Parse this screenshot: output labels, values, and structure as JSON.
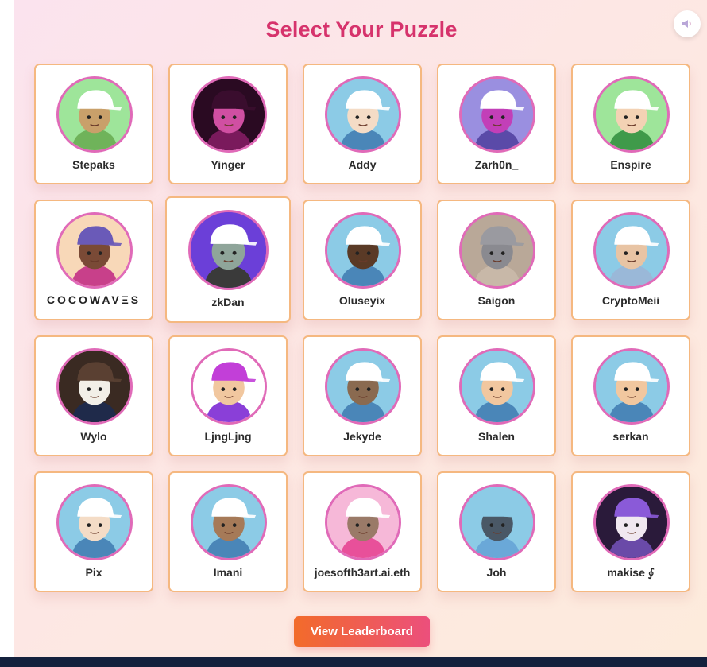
{
  "header": {
    "title": "Select Your Puzzle"
  },
  "sound_button": {
    "icon": "speaker-icon"
  },
  "accent_colors": {
    "title": "#d6336c",
    "card_border": "#f5b880",
    "avatar_ring": "#e06ab8",
    "button_start": "#f26b2a",
    "button_end": "#ec4f7c"
  },
  "puzzles": [
    {
      "name": "Stepaks",
      "bg": "#9ee59a",
      "skin": "#c9a06a",
      "cap": "#ffffff",
      "shirt": "#6fb35a"
    },
    {
      "name": "Yinger",
      "bg": "#2a0a22",
      "skin": "#d04fa2",
      "cap": "#3a0d2e",
      "shirt": "#7a1a5c"
    },
    {
      "name": "Addy",
      "bg": "#8ccbe6",
      "skin": "#f4dcc6",
      "cap": "#ffffff",
      "shirt": "#4a86b8"
    },
    {
      "name": "Zarh0n_",
      "bg": "#9a8fe0",
      "skin": "#c23fb8",
      "cap": "#ffffff",
      "shirt": "#5a4aa8"
    },
    {
      "name": "Enspire",
      "bg": "#9ee59a",
      "skin": "#f3d2b4",
      "cap": "#ffffff",
      "shirt": "#3f9a4a"
    },
    {
      "name": "COCOWAVΞS",
      "bg": "#f8d8b8",
      "skin": "#7a4a36",
      "cap": "#6a5ab8",
      "shirt": "#c8408a"
    },
    {
      "name": "zkDan",
      "bg": "#6b3fd8",
      "skin": "#8fa59a",
      "cap": "#ffffff",
      "shirt": "#3a3a3a"
    },
    {
      "name": "Oluseyix",
      "bg": "#8ccbe6",
      "skin": "#5a3a26",
      "cap": "#ffffff",
      "shirt": "#4a86b8"
    },
    {
      "name": "Saigon",
      "bg": "#b9a898",
      "skin": "#8a8a90",
      "cap": "#9a9aa0",
      "shirt": "#c8b8a8"
    },
    {
      "name": "CryptoMeii",
      "bg": "#8ccbe6",
      "skin": "#e8c4a4",
      "cap": "#ffffff",
      "shirt": "#9ab8d8"
    },
    {
      "name": "Wylo",
      "bg": "#3a2a22",
      "skin": "#f2efe8",
      "cap": "#5a4032",
      "shirt": "#1f2a4a"
    },
    {
      "name": "LjngLjng",
      "bg": "#ffffff",
      "skin": "#f1c79f",
      "cap": "#c23fd8",
      "shirt": "#8a3fd8"
    },
    {
      "name": "Jekyde",
      "bg": "#8ccbe6",
      "skin": "#8a6a50",
      "cap": "#ffffff",
      "shirt": "#4a86b8"
    },
    {
      "name": "Shalen",
      "bg": "#8ccbe6",
      "skin": "#f1c79f",
      "cap": "#ffffff",
      "shirt": "#4a86b8"
    },
    {
      "name": "serkan",
      "bg": "#8ccbe6",
      "skin": "#f1c79f",
      "cap": "#ffffff",
      "shirt": "#4a86b8"
    },
    {
      "name": "Pix",
      "bg": "#8ccbe6",
      "skin": "#f4dcc6",
      "cap": "#ffffff",
      "shirt": "#4a86b8"
    },
    {
      "name": "Imani",
      "bg": "#8ccbe6",
      "skin": "#a67a58",
      "cap": "#ffffff",
      "shirt": "#4a86b8"
    },
    {
      "name": "joesofth3art.ai.eth",
      "bg": "#f6b8d8",
      "skin": "#9a7a68",
      "cap": "#ffffff",
      "shirt": "#e8509a"
    },
    {
      "name": "Joh",
      "bg": "#8ccbe6",
      "skin": "#4a5866",
      "cap": "#8ccbe6",
      "shirt": "#6aa8d8"
    },
    {
      "name": "makise ∮",
      "bg": "#2a1a3a",
      "skin": "#f0e8f0",
      "cap": "#8a5ad8",
      "shirt": "#6a4aa8"
    }
  ],
  "leaderboard_button": {
    "label": "View Leaderboard"
  }
}
